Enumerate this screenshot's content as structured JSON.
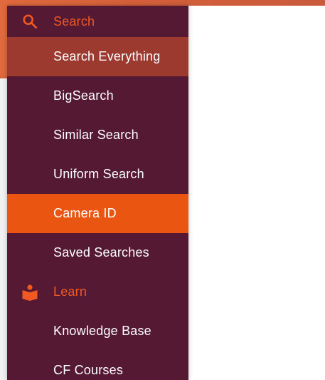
{
  "colors": {
    "menu_bg": "#551934",
    "accent": "#f05a22",
    "active_item": "#ea5612",
    "hover_item": "#9d3a2f",
    "banner": "#d4603a"
  },
  "sections": [
    {
      "label": "Search",
      "icon": "search-icon",
      "items": [
        {
          "label": "Search Everything",
          "state": "hover"
        },
        {
          "label": "BigSearch",
          "state": "normal"
        },
        {
          "label": "Similar Search",
          "state": "normal"
        },
        {
          "label": "Uniform Search",
          "state": "normal"
        },
        {
          "label": "Camera ID",
          "state": "active"
        },
        {
          "label": "Saved Searches",
          "state": "normal"
        }
      ]
    },
    {
      "label": "Learn",
      "icon": "book-reader-icon",
      "items": [
        {
          "label": "Knowledge Base",
          "state": "normal"
        },
        {
          "label": "CF Courses",
          "state": "normal"
        }
      ]
    }
  ]
}
